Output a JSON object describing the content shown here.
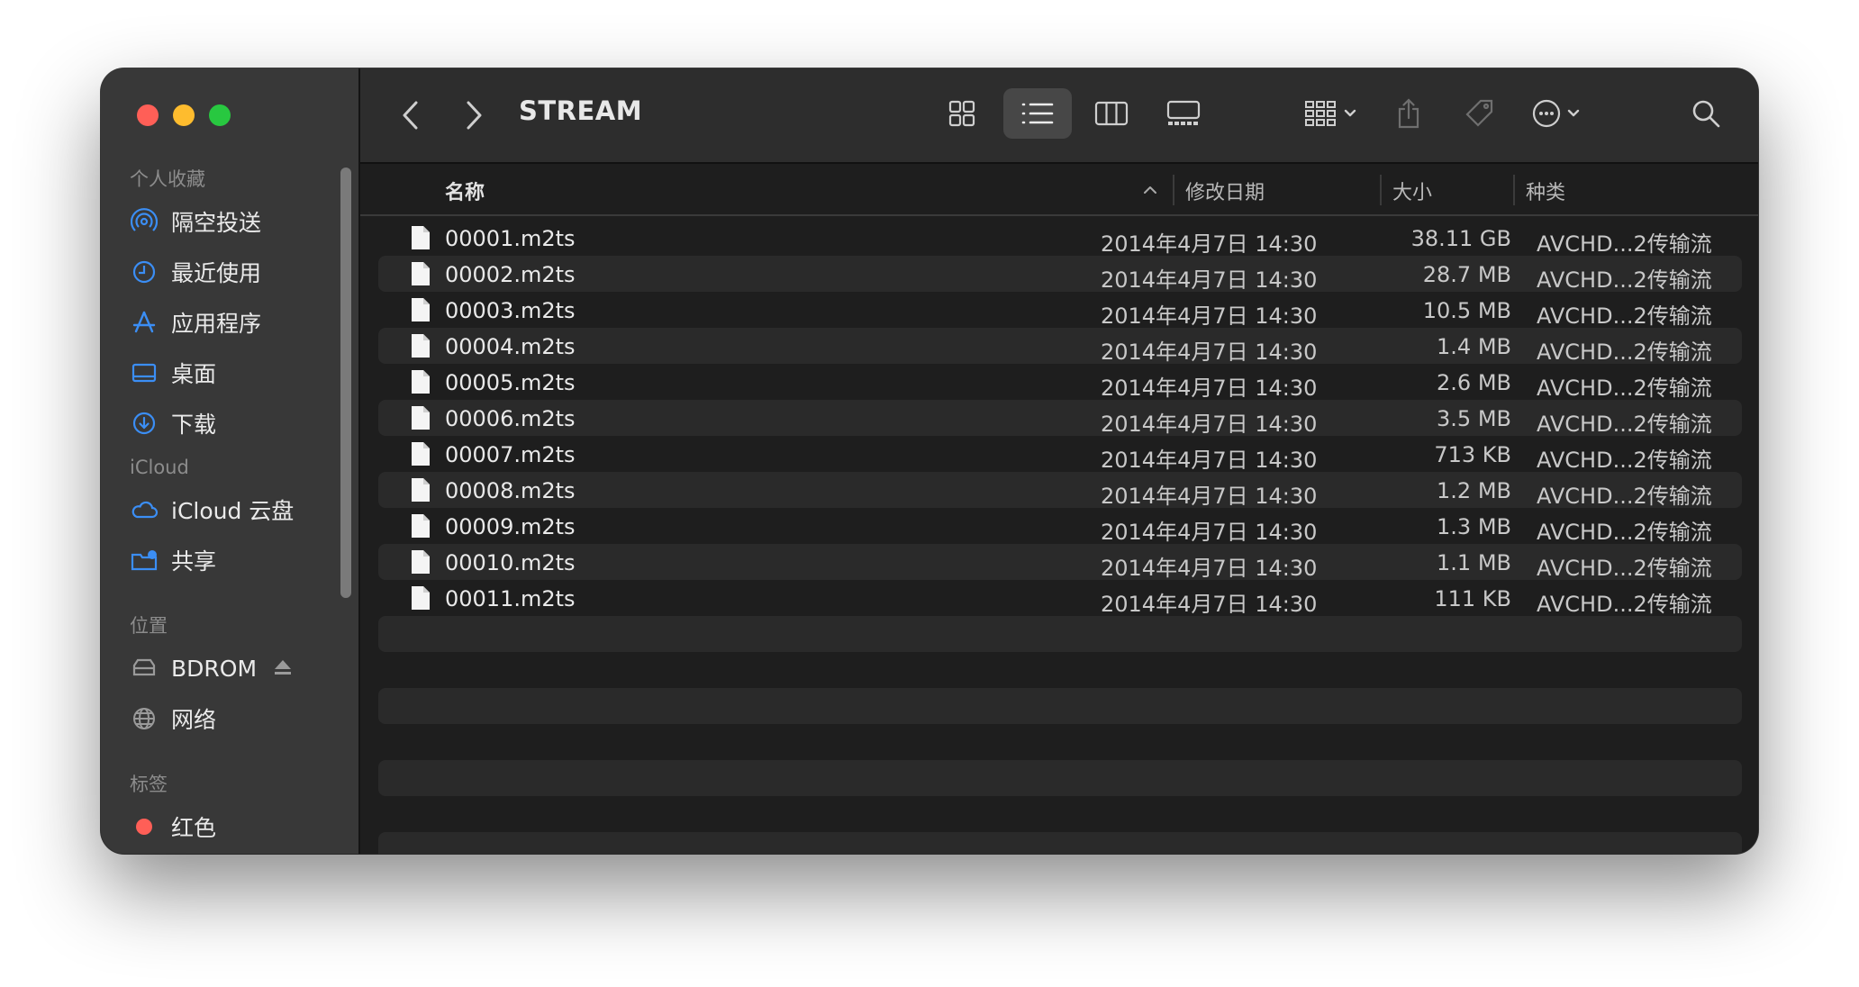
{
  "window": {
    "traffic_colors": [
      "#ff5f57",
      "#febc2e",
      "#28c840"
    ]
  },
  "sidebar": {
    "sections": [
      {
        "header": "个人收藏",
        "items": [
          {
            "label": "隔空投送",
            "icon": "airdrop-icon"
          },
          {
            "label": "最近使用",
            "icon": "clock-icon"
          },
          {
            "label": "应用程序",
            "icon": "applications-icon"
          },
          {
            "label": "桌面",
            "icon": "desktop-icon"
          },
          {
            "label": "下载",
            "icon": "download-icon"
          }
        ]
      },
      {
        "header": "iCloud",
        "items": [
          {
            "label": "iCloud 云盘",
            "icon": "cloud-icon"
          },
          {
            "label": "共享",
            "icon": "shared-folder-icon"
          }
        ]
      },
      {
        "header": "位置",
        "items": [
          {
            "label": "BDROM",
            "icon": "disk-icon",
            "eject": true
          },
          {
            "label": "网络",
            "icon": "network-globe-icon"
          }
        ]
      },
      {
        "header": "标签",
        "items": [
          {
            "label": "红色",
            "icon": "red-tag-icon"
          }
        ]
      }
    ]
  },
  "toolbar": {
    "title": "STREAM",
    "view_mode": "list"
  },
  "columns": {
    "name": "名称",
    "date": "修改日期",
    "size": "大小",
    "kind": "种类"
  },
  "files": [
    {
      "name": "00001.m2ts",
      "date": "2014年4月7日 14:30",
      "size": "38.11 GB",
      "kind": "AVCHD...2传输流"
    },
    {
      "name": "00002.m2ts",
      "date": "2014年4月7日 14:30",
      "size": "28.7 MB",
      "kind": "AVCHD...2传输流"
    },
    {
      "name": "00003.m2ts",
      "date": "2014年4月7日 14:30",
      "size": "10.5 MB",
      "kind": "AVCHD...2传输流"
    },
    {
      "name": "00004.m2ts",
      "date": "2014年4月7日 14:30",
      "size": "1.4 MB",
      "kind": "AVCHD...2传输流"
    },
    {
      "name": "00005.m2ts",
      "date": "2014年4月7日 14:30",
      "size": "2.6 MB",
      "kind": "AVCHD...2传输流"
    },
    {
      "name": "00006.m2ts",
      "date": "2014年4月7日 14:30",
      "size": "3.5 MB",
      "kind": "AVCHD...2传输流"
    },
    {
      "name": "00007.m2ts",
      "date": "2014年4月7日 14:30",
      "size": "713 KB",
      "kind": "AVCHD...2传输流"
    },
    {
      "name": "00008.m2ts",
      "date": "2014年4月7日 14:30",
      "size": "1.2 MB",
      "kind": "AVCHD...2传输流"
    },
    {
      "name": "00009.m2ts",
      "date": "2014年4月7日 14:30",
      "size": "1.3 MB",
      "kind": "AVCHD...2传输流"
    },
    {
      "name": "00010.m2ts",
      "date": "2014年4月7日 14:30",
      "size": "1.1 MB",
      "kind": "AVCHD...2传输流"
    },
    {
      "name": "00011.m2ts",
      "date": "2014年4月7日 14:30",
      "size": "111 KB",
      "kind": "AVCHD...2传输流"
    }
  ]
}
